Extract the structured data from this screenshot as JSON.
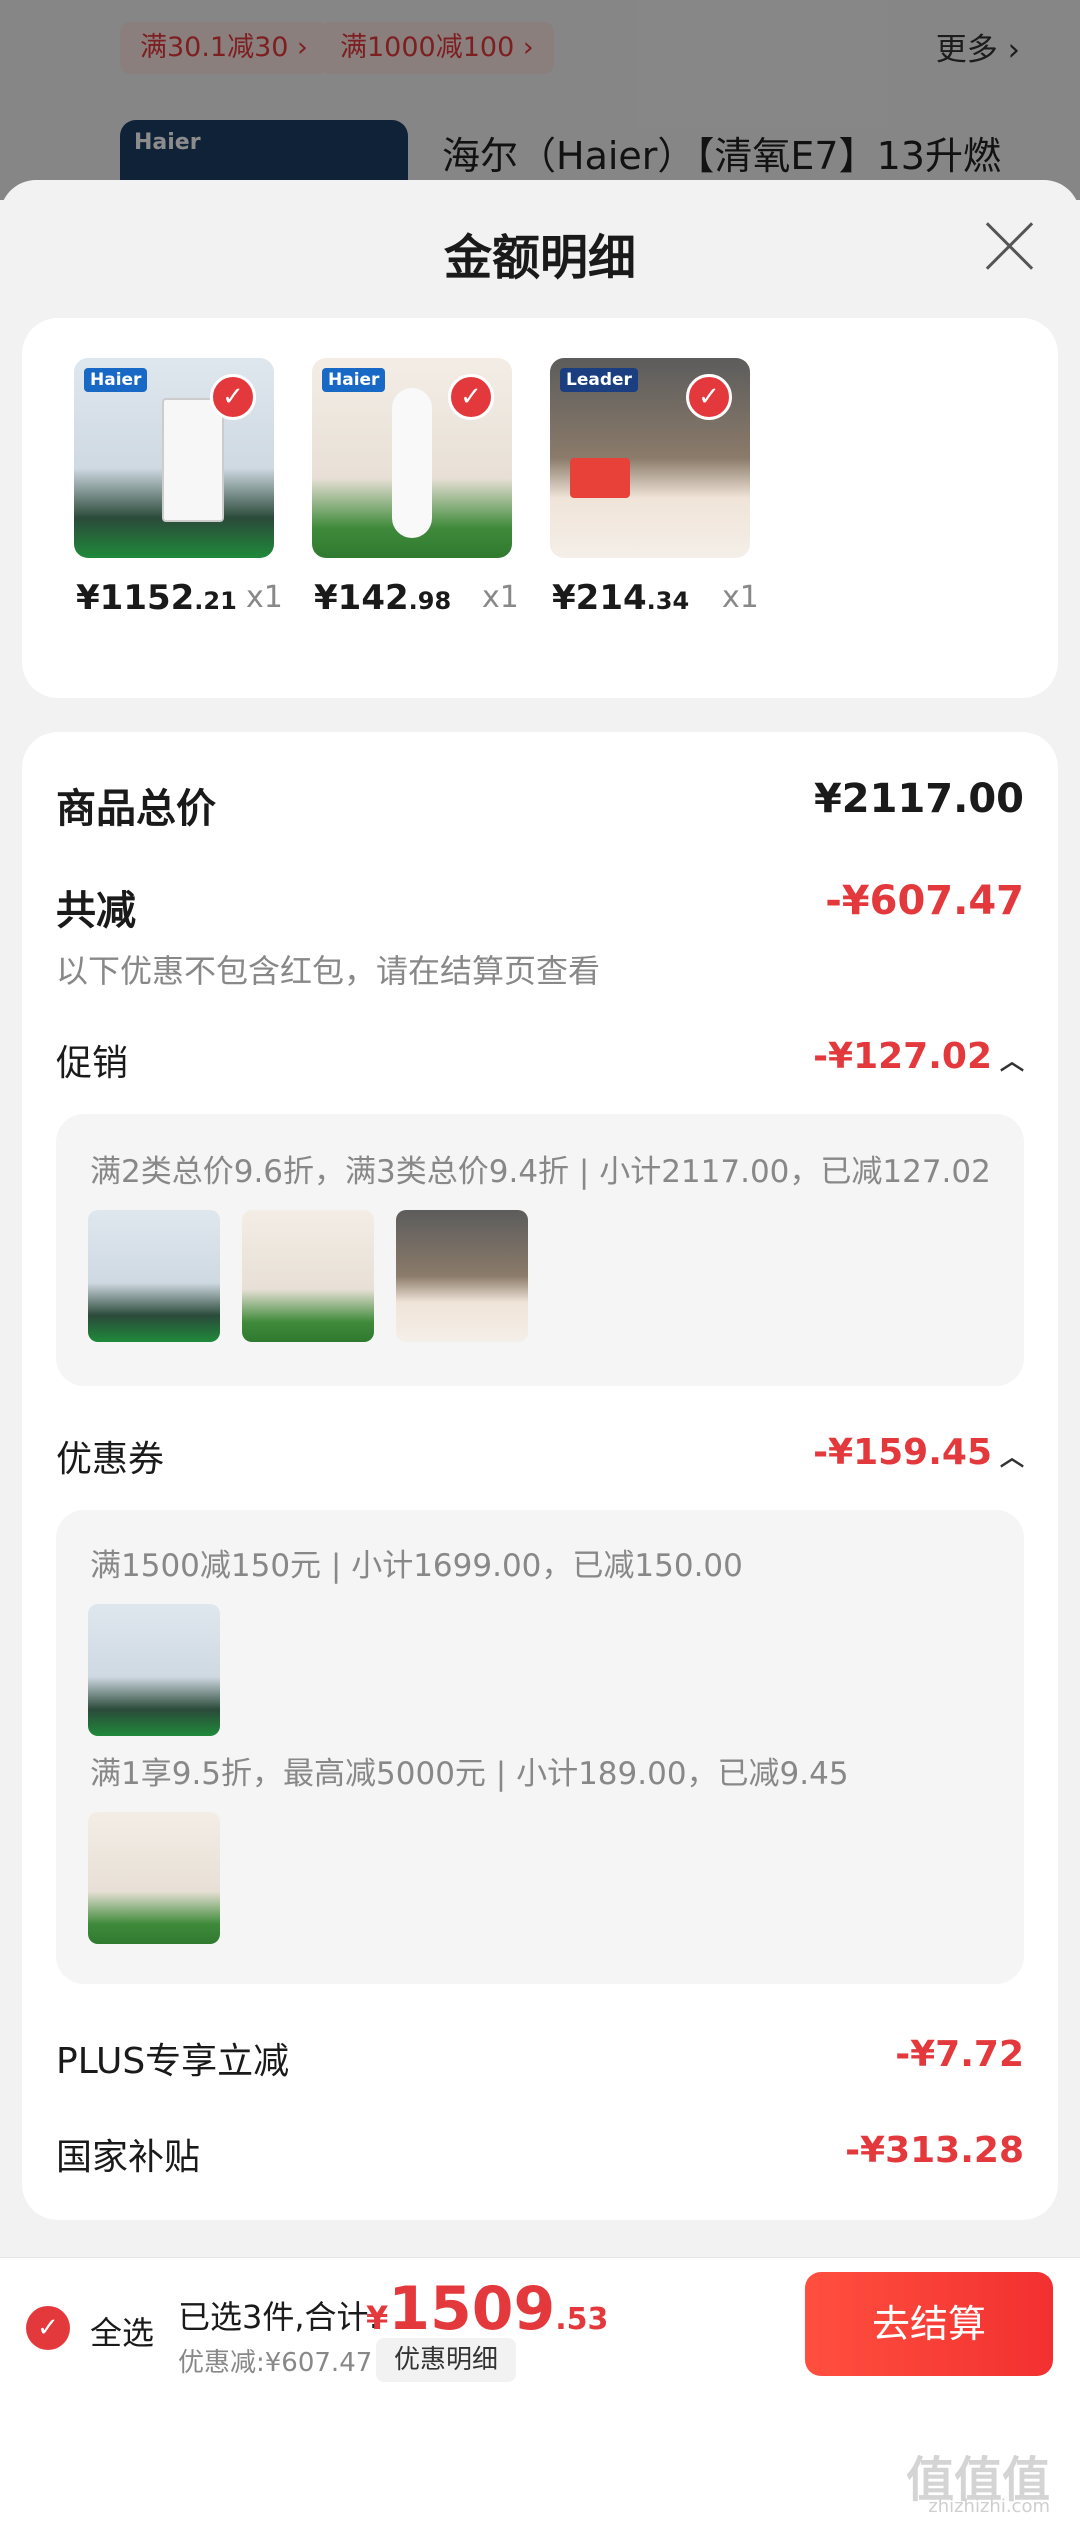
{
  "background": {
    "chips": [
      "满30.1减30 ›",
      "满1000减100 ›"
    ],
    "more": "更多 ›",
    "thumb_brand": "Haier",
    "product_title": "海尔（Haier）【清氧E7】13升燃"
  },
  "sheet": {
    "title": "金额明细",
    "products": [
      {
        "brand": "Haier",
        "price_int": "¥1152",
        "price_dec": ".21",
        "qty": "x1"
      },
      {
        "brand": "Haier",
        "price_int": "¥142",
        "price_dec": ".98",
        "qty": "x1"
      },
      {
        "brand": "Leader",
        "price_int": "¥214",
        "price_dec": ".34",
        "qty": "x1"
      }
    ]
  },
  "summary": {
    "goods_total_label": "商品总价",
    "goods_total_value": "¥2117.00",
    "discount_label": "共减",
    "discount_value": "-¥607.47",
    "discount_note": "以下优惠不包含红包，请在结算页查看",
    "promo_label": "促销",
    "promo_value": "-¥127.02",
    "promo_detail": "满2类总价9.6折，满3类总价9.4折 | 小计2117.00，已减127.02",
    "coupon_label": "优惠券",
    "coupon_value": "-¥159.45",
    "coupon_detail_1": "满1500减150元 | 小计1699.00，已减150.00",
    "coupon_detail_2": "满1享9.5折，最高减5000元 | 小计189.00，已减9.45",
    "plus_label": "PLUS专享立减",
    "plus_value": "-¥7.72",
    "subsidy_label": "国家补贴",
    "subsidy_value": "-¥313.28"
  },
  "bottom_bar": {
    "select_all": "全选",
    "selected": "已选3件,合计:",
    "currency": "¥",
    "total_int": "1509",
    "total_dec": ".53",
    "saved": "优惠减:¥607.47",
    "detail_button": "优惠明细",
    "checkout_button": "去结算"
  },
  "watermark": {
    "logo": "值值值",
    "url": "zhizhizhi.com"
  },
  "colors": {
    "accent": "#e4393c",
    "brand_blue": "#1769c5"
  }
}
